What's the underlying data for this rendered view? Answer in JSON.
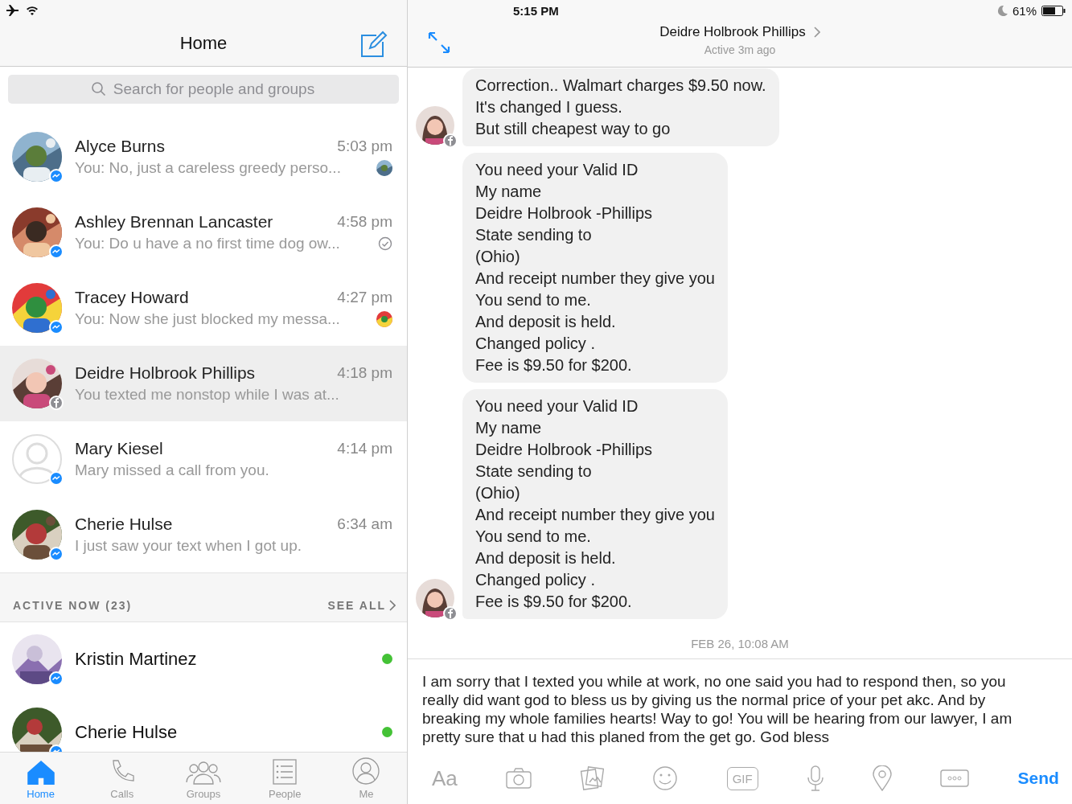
{
  "status_bar": {
    "time": "5:15 PM",
    "battery": "61%"
  },
  "sidebar": {
    "title": "Home",
    "search": {
      "placeholder": "Search for people and groups"
    },
    "conversations": [
      {
        "name": "Alyce Burns",
        "time": "5:03 pm",
        "preview": "You: No, just a careless greedy perso...",
        "photo": true,
        "messenger": true,
        "seen": true,
        "sent": false,
        "selected": false
      },
      {
        "name": "Ashley Brennan Lancaster",
        "time": "4:58 pm",
        "preview": "You: Do u have a no first time dog ow...",
        "photo": true,
        "messenger": true,
        "seen": false,
        "sent": true,
        "selected": false
      },
      {
        "name": "Tracey Howard",
        "time": "4:27 pm",
        "preview": "You: Now she just blocked my messa...",
        "photo": true,
        "messenger": true,
        "seen": true,
        "sent": false,
        "selected": false
      },
      {
        "name": "Deidre Holbrook Phillips",
        "time": "4:18 pm",
        "preview": "You texted me nonstop while I was at...",
        "photo": true,
        "messenger": false,
        "seen": false,
        "sent": false,
        "selected": true
      },
      {
        "name": "Mary Kiesel",
        "time": "4:14 pm",
        "preview": "Mary missed a call from you.",
        "photo": false,
        "messenger": true,
        "seen": false,
        "sent": false,
        "selected": false
      },
      {
        "name": "Cherie Hulse",
        "time": "6:34 am",
        "preview": "I just saw your text when I got up.",
        "photo": true,
        "messenger": true,
        "seen": false,
        "sent": false,
        "selected": false
      }
    ],
    "active_now": {
      "title": "ACTIVE NOW (23)",
      "see_all": "SEE ALL",
      "people": [
        {
          "name": "Kristin Martinez",
          "online": true
        },
        {
          "name": "Cherie Hulse",
          "online": true
        }
      ]
    },
    "tabs": [
      {
        "label": "Home",
        "selected": true
      },
      {
        "label": "Calls",
        "selected": false
      },
      {
        "label": "Groups",
        "selected": false
      },
      {
        "label": "People",
        "selected": false
      },
      {
        "label": "Me",
        "selected": false
      }
    ]
  },
  "chat": {
    "title": "Deidre Holbrook Phillips",
    "subtitle": "Active 3m ago",
    "messages": [
      {
        "lines": [
          "Correction.. Walmart charges $9.50 now.",
          "It's changed I guess.",
          "But still cheapest way to go"
        ],
        "avatar": true
      },
      {
        "lines": [
          "You need your Valid ID",
          "My name",
          "Deidre Holbrook -Phillips",
          "State sending to",
          "(Ohio)",
          "And receipt number they give you",
          "You send to me.",
          "And deposit is held.",
          "Changed policy .",
          "Fee is $9.50 for $200."
        ],
        "avatar": false
      },
      {
        "lines": [
          "You need your Valid ID",
          "My name",
          "Deidre Holbrook -Phillips",
          "State sending to",
          "(Ohio)",
          "And receipt number they give you",
          "You send to me.",
          "And deposit is held.",
          "Changed policy .",
          "Fee is $9.50 for $200."
        ],
        "avatar": true
      }
    ],
    "date": "FEB 26, 10:08 AM",
    "compose": {
      "value": "I am sorry that I texted you while at work, no one said you had to respond then, so you really did want god to bless us by giving us the normal price of your pet akc. And by breaking my whole families hearts! Way to go! You will be hearing from our lawyer, I am pretty sure that u had this planed from the get go. God bless"
    },
    "toolbar": {
      "text_button": "Aa",
      "gif_button": "GIF",
      "send": "Send"
    }
  }
}
